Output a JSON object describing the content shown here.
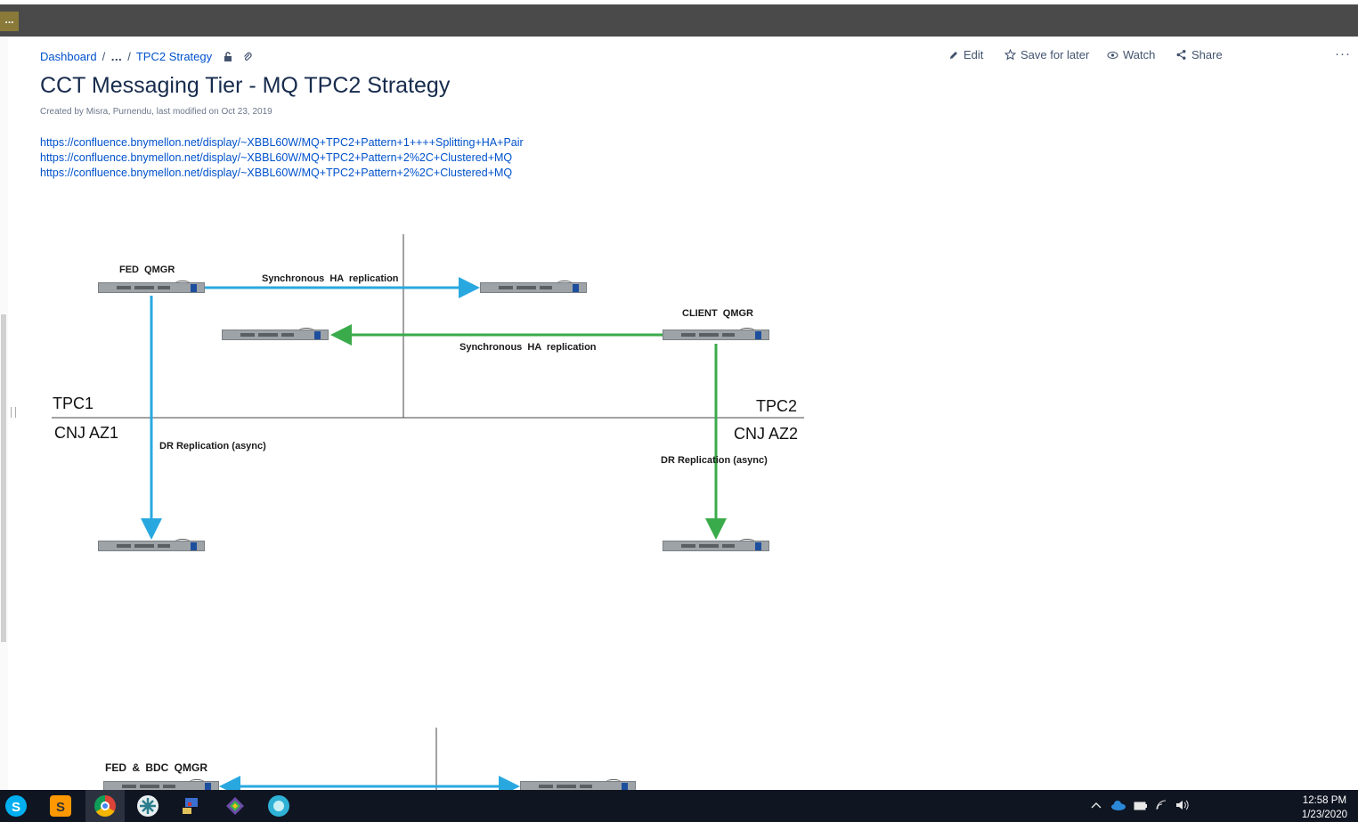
{
  "window": {
    "app_button_label": "..."
  },
  "breadcrumb": {
    "items": [
      "Dashboard",
      "…",
      "TPC2 Strategy"
    ],
    "separator": "/"
  },
  "actions": {
    "edit": "Edit",
    "save": "Save for later",
    "watch": "Watch",
    "share": "Share",
    "more": "···"
  },
  "page": {
    "title": "CCT Messaging Tier - MQ TPC2 Strategy",
    "meta": "Created by Misra, Purnendu, last modified on Oct 23, 2019",
    "links": [
      "https://confluence.bnymellon.net/display/~XBBL60W/MQ+TPC2+Pattern+1++++Splitting+HA+Pair",
      "https://confluence.bnymellon.net/display/~XBBL60W/MQ+TPC2+Pattern+2%2C+Clustered+MQ",
      "https://confluence.bnymellon.net/display/~XBBL60W/MQ+TPC2+Pattern+2%2C+Clustered+MQ"
    ]
  },
  "diagram1": {
    "fed_qmgr": "FED  QMGR",
    "sync_top": "Synchronous  HA  replication",
    "client_qmgr": "CLIENT  QMGR",
    "sync_bottom": "Synchronous  HA  replication",
    "tpc1": "TPC1",
    "az1": "CNJ AZ1",
    "tpc2": "TPC2",
    "az2": "CNJ AZ2",
    "dr_left": "DR Replication (async)",
    "dr_right": "DR Replication (async)",
    "colors": {
      "blue_arrow": "#29a8e0",
      "green_arrow": "#3aab4a"
    }
  },
  "diagram2": {
    "fed_bdc_qmgr": "FED  &  BDC QMGR"
  },
  "taskbar": {
    "icons": [
      "skype-icon",
      "sublime-icon",
      "chrome-icon",
      "app-icon",
      "network-icon",
      "git-icon",
      "browser-icon"
    ],
    "time": "12:58 PM",
    "date": "1/23/2020"
  }
}
